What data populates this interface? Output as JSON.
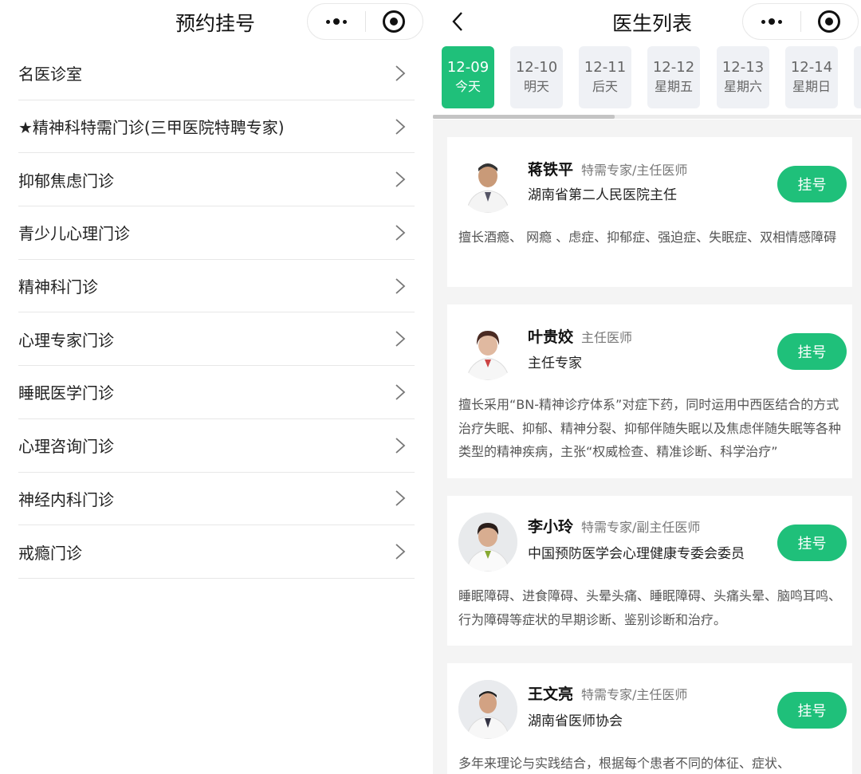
{
  "left": {
    "title": "预约挂号",
    "departments": [
      {
        "label": "名医诊室"
      },
      {
        "label": "★精神科特需门诊(三甲医院特聘专家)"
      },
      {
        "label": "抑郁焦虑门诊"
      },
      {
        "label": "青少儿心理门诊"
      },
      {
        "label": "精神科门诊"
      },
      {
        "label": "心理专家门诊"
      },
      {
        "label": "睡眠医学门诊"
      },
      {
        "label": "心理咨询门诊"
      },
      {
        "label": "神经内科门诊"
      },
      {
        "label": "戒瘾门诊"
      }
    ]
  },
  "right": {
    "title": "医生列表",
    "dates": [
      {
        "date": "12-09",
        "weekday": "今天",
        "active": true
      },
      {
        "date": "12-10",
        "weekday": "明天"
      },
      {
        "date": "12-11",
        "weekday": "后天"
      },
      {
        "date": "12-12",
        "weekday": "星期五"
      },
      {
        "date": "12-13",
        "weekday": "星期六"
      },
      {
        "date": "12-14",
        "weekday": "星期日"
      }
    ],
    "book_label": "挂号",
    "doctors": [
      {
        "name": "蒋铁平",
        "title": "特需专家/主任医师",
        "org": "湖南省第二人民医院主任",
        "desc": "擅长酒瘾、 网瘾 、虑症、抑郁症、强迫症、失眠症、双相情感障碍"
      },
      {
        "name": "叶贵姣",
        "title": "主任医师",
        "org": "主任专家",
        "desc": "擅长采用“BN-精神诊疗体系”对症下药，同时运用中西医结合的方式治疗失眠、抑郁、精神分裂、抑郁伴随失眠以及焦虑伴随失眠等各种类型的精神疾病，主张“权威检查、精准诊断、科学治疗”"
      },
      {
        "name": "李小玲",
        "title": "特需专家/副主任医师",
        "org": "中国预防医学会心理健康专委会委员",
        "desc": "睡眠障碍、进食障碍、头晕头痛、睡眠障碍、头痛头晕、脑鸣耳鸣、行为障碍等症状的早期诊断、鉴别诊断和治疗。"
      },
      {
        "name": "王文亮",
        "title": "特需专家/主任医师",
        "org": "湖南省医师协会",
        "desc": "多年来理论与实践结合，根据每个患者不同的体征、症状、"
      }
    ]
  }
}
